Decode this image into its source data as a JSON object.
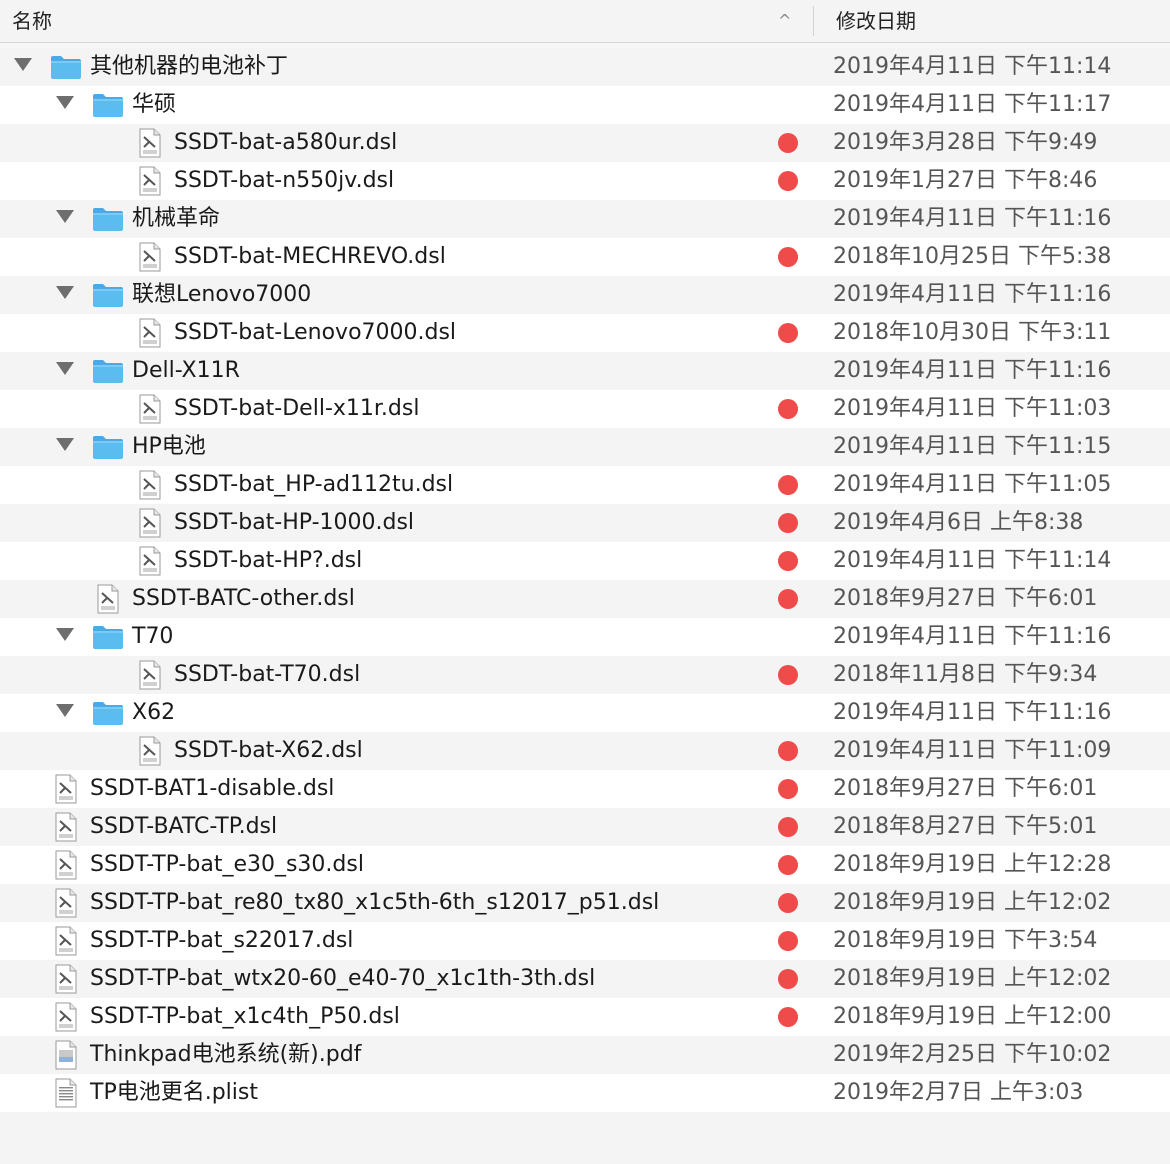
{
  "header": {
    "name_label": "名称",
    "date_label": "修改日期",
    "sort_indicator": "^"
  },
  "colors": {
    "tag_red": "#ee4b4a",
    "folder_blue": "#5bbcf0",
    "row_alt": "#f4f4f4"
  },
  "rows": [
    {
      "name": "其他机器的电池补丁",
      "date": "2019年4月11日 下午11:14",
      "kind": "folder",
      "depth": 0,
      "expanded": true,
      "tag": false
    },
    {
      "name": "华硕",
      "date": "2019年4月11日 下午11:17",
      "kind": "folder",
      "depth": 1,
      "expanded": true,
      "tag": false
    },
    {
      "name": "SSDT-bat-a580ur.dsl",
      "date": "2019年3月28日 下午9:49",
      "kind": "dsl",
      "depth": 2,
      "tag": true
    },
    {
      "name": "SSDT-bat-n550jv.dsl",
      "date": "2019年1月27日 下午8:46",
      "kind": "dsl",
      "depth": 2,
      "tag": true
    },
    {
      "name": "机械革命",
      "date": "2019年4月11日 下午11:16",
      "kind": "folder",
      "depth": 1,
      "expanded": true,
      "tag": false
    },
    {
      "name": "SSDT-bat-MECHREVO.dsl",
      "date": "2018年10月25日 下午5:38",
      "kind": "dsl",
      "depth": 2,
      "tag": true
    },
    {
      "name": "联想Lenovo7000",
      "date": "2019年4月11日 下午11:16",
      "kind": "folder",
      "depth": 1,
      "expanded": true,
      "tag": false
    },
    {
      "name": "SSDT-bat-Lenovo7000.dsl",
      "date": "2018年10月30日 下午3:11",
      "kind": "dsl",
      "depth": 2,
      "tag": true
    },
    {
      "name": "Dell-X11R",
      "date": "2019年4月11日 下午11:16",
      "kind": "folder",
      "depth": 1,
      "expanded": true,
      "tag": false
    },
    {
      "name": "SSDT-bat-Dell-x11r.dsl",
      "date": "2019年4月11日 下午11:03",
      "kind": "dsl",
      "depth": 2,
      "tag": true
    },
    {
      "name": "HP电池",
      "date": "2019年4月11日 下午11:15",
      "kind": "folder",
      "depth": 1,
      "expanded": true,
      "tag": false
    },
    {
      "name": "SSDT-bat_HP-ad112tu.dsl",
      "date": "2019年4月11日 下午11:05",
      "kind": "dsl",
      "depth": 2,
      "tag": true
    },
    {
      "name": "SSDT-bat-HP-1000.dsl",
      "date": "2019年4月6日 上午8:38",
      "kind": "dsl",
      "depth": 2,
      "tag": true
    },
    {
      "name": "SSDT-bat-HP?.dsl",
      "date": "2019年4月11日 下午11:14",
      "kind": "dsl",
      "depth": 2,
      "tag": true
    },
    {
      "name": "SSDT-BATC-other.dsl",
      "date": "2018年9月27日 下午6:01",
      "kind": "dsl",
      "depth": 1,
      "tag": true
    },
    {
      "name": "T70",
      "date": "2019年4月11日 下午11:16",
      "kind": "folder",
      "depth": 1,
      "expanded": true,
      "tag": false
    },
    {
      "name": "SSDT-bat-T70.dsl",
      "date": "2018年11月8日 下午9:34",
      "kind": "dsl",
      "depth": 2,
      "tag": true
    },
    {
      "name": "X62",
      "date": "2019年4月11日 下午11:16",
      "kind": "folder",
      "depth": 1,
      "expanded": true,
      "tag": false
    },
    {
      "name": "SSDT-bat-X62.dsl",
      "date": "2019年4月11日 下午11:09",
      "kind": "dsl",
      "depth": 2,
      "tag": true
    },
    {
      "name": "SSDT-BAT1-disable.dsl",
      "date": "2018年9月27日 下午6:01",
      "kind": "dsl",
      "depth": 0,
      "tag": true
    },
    {
      "name": "SSDT-BATC-TP.dsl",
      "date": "2018年8月27日 下午5:01",
      "kind": "dsl",
      "depth": 0,
      "tag": true
    },
    {
      "name": "SSDT-TP-bat_e30_s30.dsl",
      "date": "2018年9月19日 上午12:28",
      "kind": "dsl",
      "depth": 0,
      "tag": true
    },
    {
      "name": "SSDT-TP-bat_re80_tx80_x1c5th-6th_s12017_p51.dsl",
      "date": "2018年9月19日 上午12:02",
      "kind": "dsl",
      "depth": 0,
      "tag": true
    },
    {
      "name": "SSDT-TP-bat_s22017.dsl",
      "date": "2018年9月19日 下午3:54",
      "kind": "dsl",
      "depth": 0,
      "tag": true
    },
    {
      "name": "SSDT-TP-bat_wtx20-60_e40-70_x1c1th-3th.dsl",
      "date": "2018年9月19日 上午12:02",
      "kind": "dsl",
      "depth": 0,
      "tag": true
    },
    {
      "name": "SSDT-TP-bat_x1c4th_P50.dsl",
      "date": "2018年9月19日 上午12:00",
      "kind": "dsl",
      "depth": 0,
      "tag": true
    },
    {
      "name": "Thinkpad电池系统(新).pdf",
      "date": "2019年2月25日 下午10:02",
      "kind": "pdf",
      "depth": 0,
      "tag": false
    },
    {
      "name": "TP电池更名.plist",
      "date": "2019年2月7日 上午3:03",
      "kind": "plist",
      "depth": 0,
      "tag": false
    }
  ]
}
